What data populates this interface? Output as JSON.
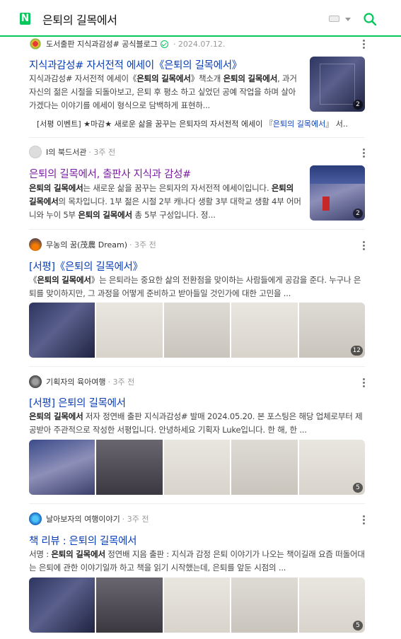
{
  "header": {
    "logo": "N",
    "query": "은퇴의 길목에서",
    "icons": {
      "keyboard": "keyboard-icon",
      "search": "search-icon"
    },
    "accent_color": "#03c75a"
  },
  "posts": [
    {
      "source": "도서출판 지식과감성# 공식블로그",
      "date": "2024.07.12.",
      "title": "지식과감성# 자서전적 에세이《은퇴의 길목에서》",
      "desc": [
        "지식과감성# 자서전적 에세이《",
        "은퇴의 길목에서",
        "》책소개 ",
        "은퇴의 길목에",
        "서",
        ", 과거 자신의 젊은 시절을 되돌아보고, 은퇴 후 평소 하고 싶었던 공예 작업을 하며 살아가겠다는 이야기를 에세이 형식으로 담백하게 표현하..."
      ],
      "thumb_count": "2",
      "sub_prefix": "[서평 이벤트] ★마감★ 새로운 삶을 꿈꾸는 은퇴자의 자서전적 에세이 『",
      "sub_highlight": "은퇴의 길목에서",
      "sub_suffix": "』 서..."
    },
    {
      "source": "I의 북드서관",
      "date": "3주 전",
      "title_hl": "은퇴의 길목에서",
      "title_rest": ", 출판사 지식과 감성#",
      "desc": [
        "은퇴의 길목에서",
        "는 새로운 삶을 꿈꾸는 은퇴자의 자서전적 에세이입니다. ",
        "은퇴의 길목에서",
        "의 목차입니다. 1부 젊은 시절 2부 캐나다 생활 3부 대학교 생활 4부 어머니와 누이 5부 ",
        "은퇴의 길목에서",
        " 총 5부 구성입니다. 정..."
      ],
      "thumb_count": "2"
    },
    {
      "source": "무농의 꿈(茂農 Dream)",
      "date": "3주 전",
      "title": "[서평]《은퇴의 길목에서》",
      "desc": [
        "《",
        "은퇴의 길목에서",
        "》는 은퇴라는 중요한 삶의 전환점을 맞이하는 사람들에게 공감을 준다. 누구나 은퇴를 맞이하지만, 그 과정을 어떻게 준비하고 받아들일 것인가에 대한 고민을 ..."
      ],
      "gallery_count": "12"
    },
    {
      "source": "기획자의 육아여행",
      "date": "3주 전",
      "title": "[서평] 은퇴의 길목에서",
      "desc": [
        "은퇴의 길목에서",
        " 저자 정연배 출판 지식과감성# 발매 2024.05.20. 본 포스팅은 해당 업체로부터 제공받아 주관적으로 작성한 서평입니다. 안녕하세요 기획자 Luke입니다. 한 해, 한 ..."
      ],
      "gallery_count": "5"
    },
    {
      "source": "날아보자의 여행이야기",
      "date": "3주 전",
      "title": "책 리뷰 : 은퇴의 길목에서",
      "desc": [
        "서명 : ",
        "은퇴의 길목에서",
        " 정연배 지음 출판 : 지식과 감정 은퇴 이야기가 나오는 책이길래 요즘 떠돌어대는 은퇴에 관한 이야기일까 하고 책을 읽기 시작했는데, 은퇴를 앞둔 시점의 ..."
      ],
      "gallery_count": "5"
    }
  ]
}
